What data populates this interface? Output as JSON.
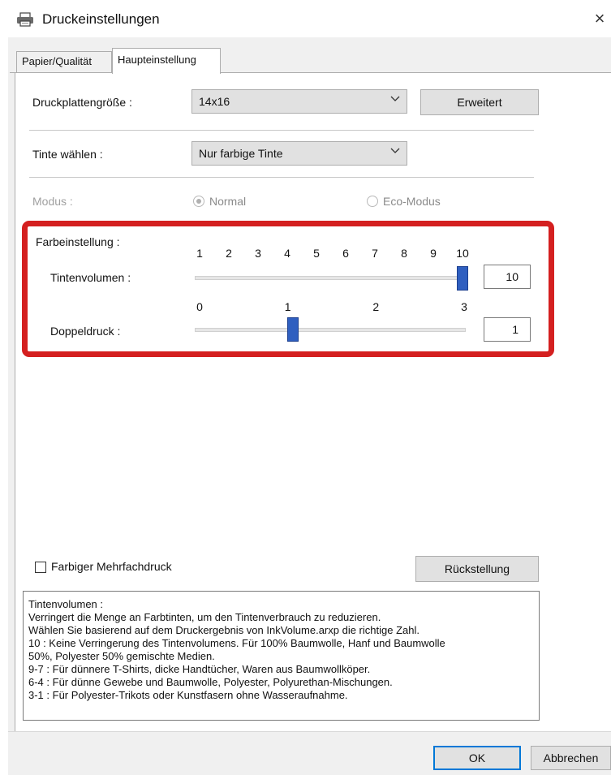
{
  "window": {
    "title": "Druckeinstellungen",
    "close_glyph": "×",
    "icon": "printer-icon"
  },
  "tabs": [
    {
      "label": "Papier/Qualität",
      "active": false
    },
    {
      "label": "Haupteinstellung",
      "active": true
    }
  ],
  "plate_size": {
    "label": "Druckplattengröße :",
    "value": "14x16",
    "advanced_button": "Erweitert"
  },
  "ink": {
    "label": "Tinte wählen :",
    "value": "Nur farbige Tinte"
  },
  "mode": {
    "label": "Modus :",
    "options": [
      {
        "label": "Normal",
        "selected": true
      },
      {
        "label": "Eco-Modus",
        "selected": false
      }
    ],
    "enabled": false
  },
  "color_settings": {
    "label": "Farbeinstellung :",
    "ink_volume": {
      "label": "Tintenvolumen :",
      "ticks": [
        "1",
        "2",
        "3",
        "4",
        "5",
        "6",
        "7",
        "8",
        "9",
        "10"
      ],
      "min": 1,
      "max": 10,
      "value": 10,
      "value_text": "10"
    },
    "double_print": {
      "label": "Doppeldruck :",
      "ticks": [
        "0",
        "1",
        "2",
        "3"
      ],
      "min": 0,
      "max": 3,
      "value": 1,
      "value_text": "1"
    },
    "highlight_color": "#d42020",
    "thumb_color": "#2f5fc0"
  },
  "multi_color_print": {
    "label": "Farbiger Mehrfachdruck",
    "checked": false
  },
  "reset_button": "Rückstellung",
  "description": [
    "Tintenvolumen :",
    "Verringert die Menge an Farbtinten, um den Tintenverbrauch zu reduzieren.",
    "Wählen Sie basierend auf dem Druckergebnis von InkVolume.arxp die richtige Zahl.",
    "10 : Keine Verringerung des Tintenvolumens. Für 100% Baumwolle, Hanf und Baumwolle",
    "50%, Polyester 50% gemischte Medien.",
    "9-7 : Für dünnere T-Shirts, dicke Handtücher, Waren aus Baumwollköper.",
    "6-4 : Für dünne Gewebe und Baumwolle, Polyester, Polyurethan-Mischungen.",
    "3-1 : Für Polyester-Trikots oder Kunstfasern ohne Wasseraufnahme."
  ],
  "footer": {
    "ok": "OK",
    "cancel": "Abbrechen"
  }
}
